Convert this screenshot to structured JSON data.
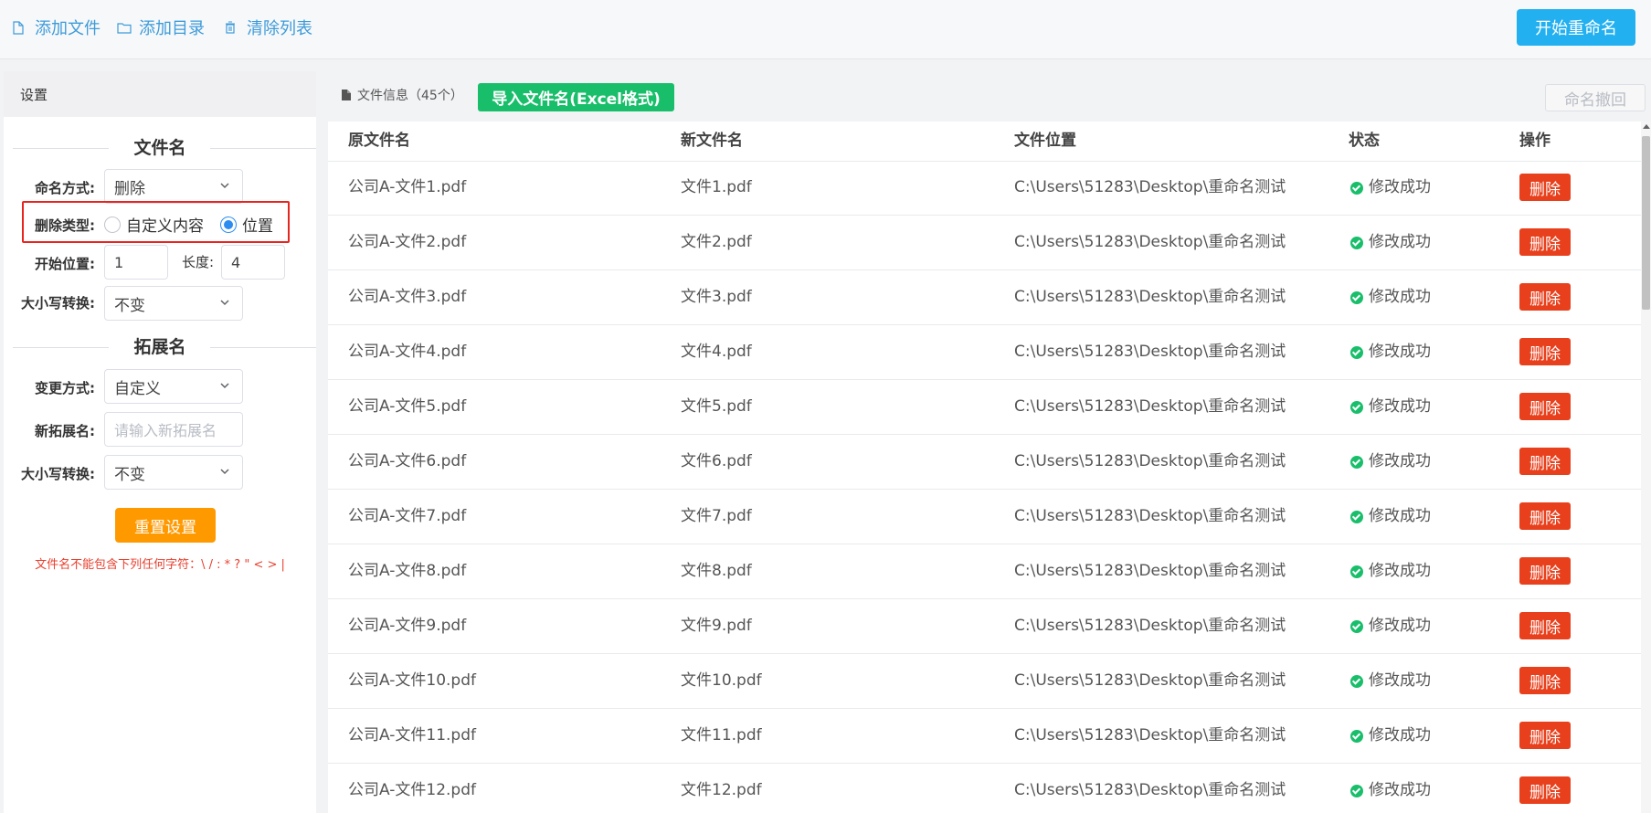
{
  "toolbar": {
    "add_file": "添加文件",
    "add_dir": "添加目录",
    "clear_list": "清除列表",
    "start_rename": "开始重命名"
  },
  "settings": {
    "header": "设置",
    "filename_section": "文件名",
    "naming_mode_label": "命名方式:",
    "naming_mode_value": "删除",
    "delete_type_label": "删除类型:",
    "delete_type_options": [
      "自定义内容",
      "位置"
    ],
    "delete_type_selected": "位置",
    "start_pos_label": "开始位置:",
    "start_pos_value": "1",
    "length_label": "长度:",
    "length_value": "4",
    "case_label": "大小写转换:",
    "case_value": "不变",
    "ext_section": "拓展名",
    "change_mode_label": "变更方式:",
    "change_mode_value": "自定义",
    "new_ext_label": "新拓展名:",
    "new_ext_placeholder": "请输入新拓展名",
    "ext_case_label": "大小写转换:",
    "ext_case_value": "不变",
    "reset_button": "重置设置",
    "warning": "文件名不能包含下列任何字符：\\ / : * ? \" < > |"
  },
  "file_panel": {
    "title": "文件信息",
    "count": "（45个）",
    "import_button": "导入文件名(Excel格式)",
    "undo_button": "命名撤回",
    "columns": [
      "原文件名",
      "新文件名",
      "文件位置",
      "状态",
      "操作"
    ],
    "rows": [
      {
        "orig": "公司A-文件1.pdf",
        "new": "文件1.pdf",
        "path": "C:\\Users\\51283\\Desktop\\重命名测试",
        "status": "修改成功",
        "action": "删除"
      },
      {
        "orig": "公司A-文件2.pdf",
        "new": "文件2.pdf",
        "path": "C:\\Users\\51283\\Desktop\\重命名测试",
        "status": "修改成功",
        "action": "删除"
      },
      {
        "orig": "公司A-文件3.pdf",
        "new": "文件3.pdf",
        "path": "C:\\Users\\51283\\Desktop\\重命名测试",
        "status": "修改成功",
        "action": "删除"
      },
      {
        "orig": "公司A-文件4.pdf",
        "new": "文件4.pdf",
        "path": "C:\\Users\\51283\\Desktop\\重命名测试",
        "status": "修改成功",
        "action": "删除"
      },
      {
        "orig": "公司A-文件5.pdf",
        "new": "文件5.pdf",
        "path": "C:\\Users\\51283\\Desktop\\重命名测试",
        "status": "修改成功",
        "action": "删除"
      },
      {
        "orig": "公司A-文件6.pdf",
        "new": "文件6.pdf",
        "path": "C:\\Users\\51283\\Desktop\\重命名测试",
        "status": "修改成功",
        "action": "删除"
      },
      {
        "orig": "公司A-文件7.pdf",
        "new": "文件7.pdf",
        "path": "C:\\Users\\51283\\Desktop\\重命名测试",
        "status": "修改成功",
        "action": "删除"
      },
      {
        "orig": "公司A-文件8.pdf",
        "new": "文件8.pdf",
        "path": "C:\\Users\\51283\\Desktop\\重命名测试",
        "status": "修改成功",
        "action": "删除"
      },
      {
        "orig": "公司A-文件9.pdf",
        "new": "文件9.pdf",
        "path": "C:\\Users\\51283\\Desktop\\重命名测试",
        "status": "修改成功",
        "action": "删除"
      },
      {
        "orig": "公司A-文件10.pdf",
        "new": "文件10.pdf",
        "path": "C:\\Users\\51283\\Desktop\\重命名测试",
        "status": "修改成功",
        "action": "删除"
      },
      {
        "orig": "公司A-文件11.pdf",
        "new": "文件11.pdf",
        "path": "C:\\Users\\51283\\Desktop\\重命名测试",
        "status": "修改成功",
        "action": "删除"
      },
      {
        "orig": "公司A-文件12.pdf",
        "new": "文件12.pdf",
        "path": "C:\\Users\\51283\\Desktop\\重命名测试",
        "status": "修改成功",
        "action": "删除"
      }
    ]
  },
  "colors": {
    "link_blue": "#3d9bd9",
    "start_button": "#22b0f0",
    "import_button": "#19be6b",
    "delete_button": "#e8401c",
    "reset_button": "#ff9900",
    "highlight_box": "#e8241f",
    "success_green": "#19be6b"
  },
  "icons": {
    "add_file": "file-icon",
    "add_dir": "folder-icon",
    "clear_list": "trash-icon",
    "file_info": "document-icon",
    "status": "check-circle-icon",
    "select": "chevron-down-icon"
  }
}
